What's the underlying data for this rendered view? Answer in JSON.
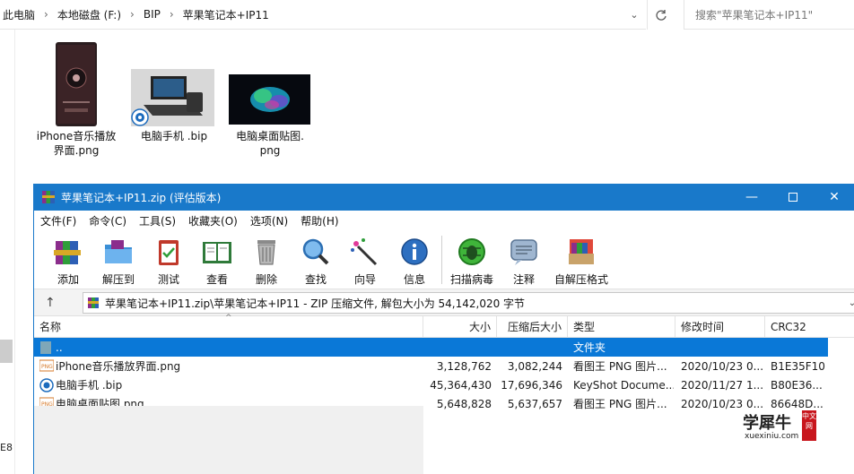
{
  "explorer": {
    "breadcrumb": [
      "此电脑",
      "本地磁盘 (F:)",
      "BIP",
      "苹果笔记本+IP11"
    ],
    "search_placeholder": "搜索\"苹果笔记本+IP11\"",
    "nav_fragment": "E8",
    "files": [
      {
        "name_line1": "iPhone音乐播放",
        "name_line2": "界面.png"
      },
      {
        "name_line1": "电脑手机 .bip",
        "name_line2": ""
      },
      {
        "name_line1": "电脑桌面贴图.",
        "name_line2": "png"
      }
    ]
  },
  "winrar": {
    "title": "苹果笔记本+IP11.zip (评估版本)",
    "menu": [
      "文件(F)",
      "命令(C)",
      "工具(S)",
      "收藏夹(O)",
      "选项(N)",
      "帮助(H)"
    ],
    "toolbar": [
      "添加",
      "解压到",
      "测试",
      "查看",
      "删除",
      "查找",
      "向导",
      "信息",
      "扫描病毒",
      "注释",
      "自解压格式"
    ],
    "path": "苹果笔记本+IP11.zip\\苹果笔记本+IP11 - ZIP 压缩文件, 解包大小为 54,142,020 字节",
    "columns": [
      "名称",
      "大小",
      "压缩后大小",
      "类型",
      "修改时间",
      "CRC32"
    ],
    "rows": [
      {
        "name": "..",
        "size": "",
        "packed": "",
        "type": "文件夹",
        "modified": "",
        "crc": ""
      },
      {
        "name": "iPhone音乐播放界面.png",
        "size": "3,128,762",
        "packed": "3,082,244",
        "type": "看图王 PNG 图片...",
        "modified": "2020/10/23 0...",
        "crc": "B1E35F10"
      },
      {
        "name": "电脑手机 .bip",
        "size": "45,364,430",
        "packed": "17,696,346",
        "type": "KeyShot Docume...",
        "modified": "2020/11/27 1...",
        "crc": "B80E36..."
      },
      {
        "name": "电脑桌面贴图.png",
        "size": "5,648,828",
        "packed": "5,637,657",
        "type": "看图王 PNG 图片...",
        "modified": "2020/10/23 0...",
        "crc": "86648D..."
      }
    ]
  },
  "watermark": {
    "main": "学犀牛",
    "sub": "xuexiniu.com",
    "badge": "中文网"
  },
  "colors": {
    "titlebar": "#1979ca",
    "selection": "#0a78d7"
  }
}
